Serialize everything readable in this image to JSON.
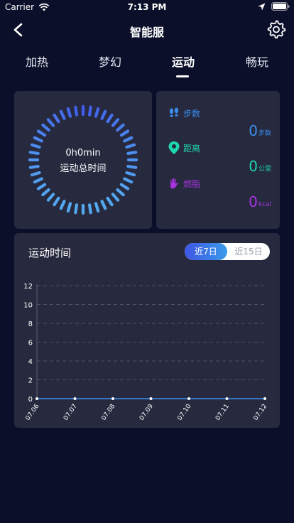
{
  "status_bar": {
    "carrier": "Carrier",
    "time": "7:13 PM"
  },
  "nav": {
    "title": "智能服"
  },
  "tabs": [
    {
      "label": "加热",
      "active": false
    },
    {
      "label": "梦幻",
      "active": false
    },
    {
      "label": "运动",
      "active": true
    },
    {
      "label": "畅玩",
      "active": false
    }
  ],
  "summary": {
    "total_time": "0h0min",
    "total_time_label": "运动总时间"
  },
  "metrics": {
    "steps": {
      "label": "步数",
      "value": "0",
      "unit": "步数",
      "color": "#3a8ef0"
    },
    "distance": {
      "label": "距离",
      "value": "0",
      "unit": "公里",
      "color": "#1ed6b0"
    },
    "calories": {
      "label": "燃脂",
      "value": "0",
      "unit": "kcal",
      "color": "#a833e0"
    }
  },
  "chart_section": {
    "title": "运动时间",
    "range_options": [
      {
        "label": "近7日",
        "selected": true
      },
      {
        "label": "近15日",
        "selected": false
      }
    ]
  },
  "chart_data": {
    "type": "line",
    "categories": [
      "07.06",
      "07.07",
      "07.08",
      "07.09",
      "07.10",
      "07.11",
      "07.12"
    ],
    "values": [
      0,
      0,
      0,
      0,
      0,
      0,
      0
    ],
    "yticks": [
      0,
      2,
      4,
      6,
      8,
      10,
      12
    ],
    "ylim": [
      0,
      12
    ],
    "title": "",
    "xlabel": "",
    "ylabel": "",
    "grid": true
  },
  "colors": {
    "background": "#0b0f2a",
    "card": "#272a3f",
    "accent": "#3a8ef0"
  }
}
